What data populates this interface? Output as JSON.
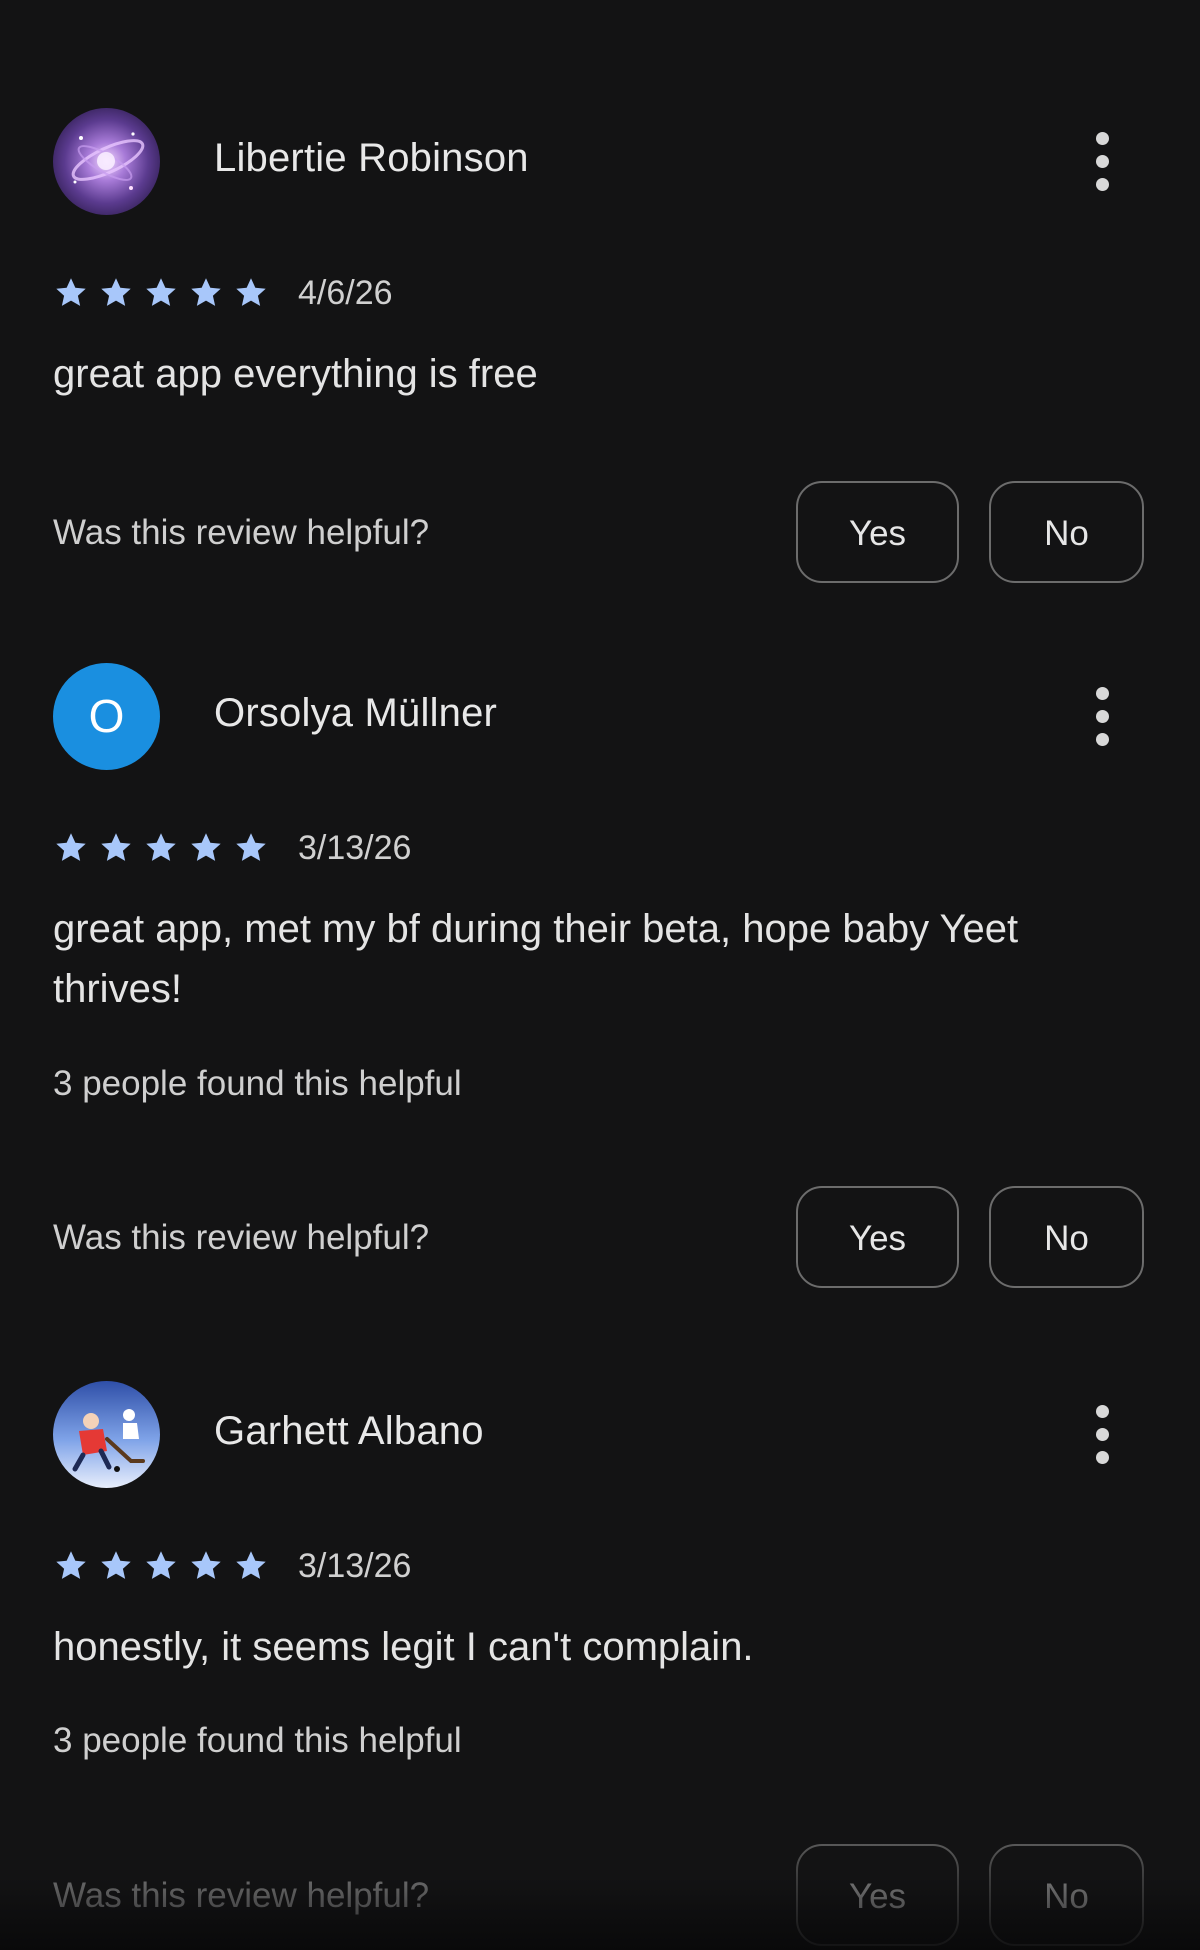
{
  "colors": {
    "background": "#131314",
    "star": "#a8c7fa",
    "text": "#e3e3e3",
    "button_border": "#6c6c6c",
    "avatar_letter_bg": "#1a8fe0"
  },
  "reviews": [
    {
      "reviewer": "Libertie Robinson",
      "avatar_type": "image",
      "avatar_icon": "galaxy-avatar-icon",
      "stars": 5,
      "date": "4/6/26",
      "text": "great app everything is free",
      "helpful_count": "",
      "helpful_question": "Was this review helpful?",
      "yes_label": "Yes",
      "no_label": "No"
    },
    {
      "reviewer": "Orsolya Müllner",
      "avatar_type": "letter",
      "avatar_letter": "O",
      "stars": 5,
      "date": "3/13/26",
      "text": "great app, met my bf during their beta, hope baby Yeet thrives!",
      "helpful_count": "3 people found this helpful",
      "helpful_question": "Was this review helpful?",
      "yes_label": "Yes",
      "no_label": "No"
    },
    {
      "reviewer": "Garhett Albano",
      "avatar_type": "image",
      "avatar_icon": "hockey-avatar-icon",
      "stars": 5,
      "date": "3/13/26",
      "text": "honestly, it seems legit I can't complain.",
      "helpful_count": "3 people found this helpful",
      "helpful_question": "Was this review helpful?",
      "yes_label": "Yes",
      "no_label": "No"
    }
  ]
}
